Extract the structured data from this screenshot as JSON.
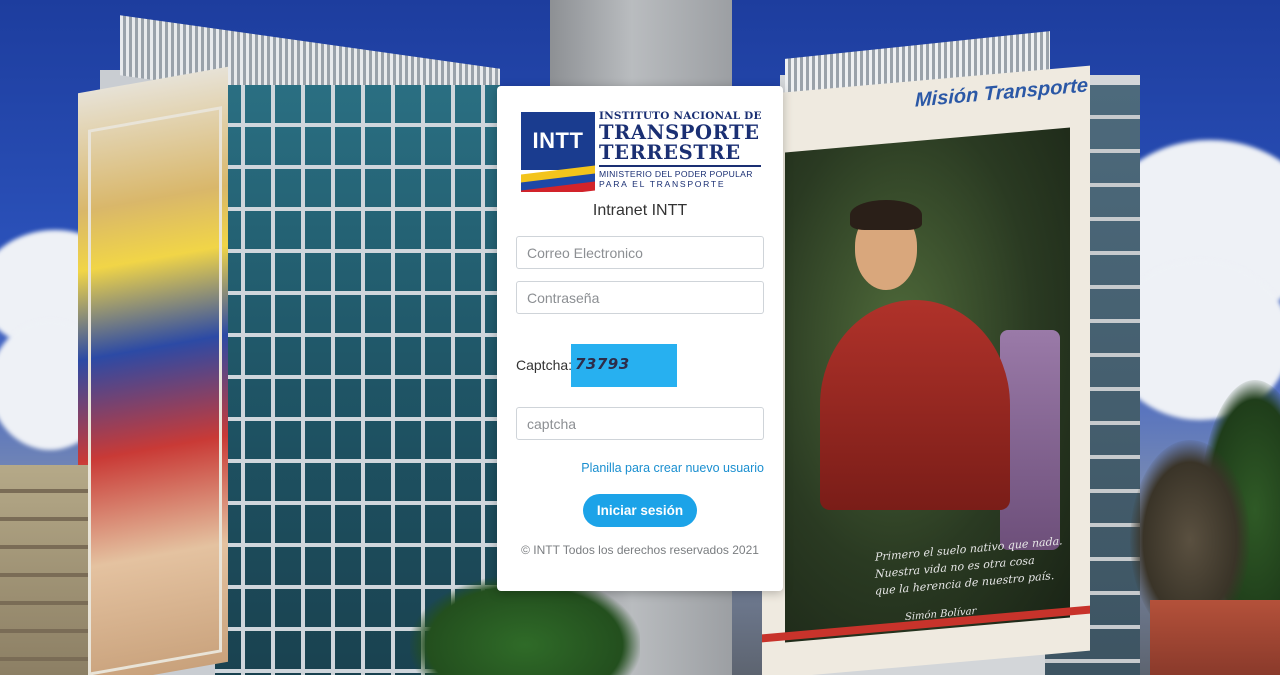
{
  "logo": {
    "abbr": "INTT",
    "line1": "INSTITUTO NACIONAL DE",
    "line2": "TRANSPORTE",
    "line3": "TERRESTRE",
    "ministry1": "MINISTERIO DEL PODER POPULAR",
    "ministry2": "PARA EL TRANSPORTE"
  },
  "title": "Intranet INTT",
  "form": {
    "email_placeholder": "Correo Electronico",
    "password_placeholder": "Contraseña",
    "captcha_label": "Captcha:",
    "captcha_code": "73793",
    "captcha_placeholder": "captcha",
    "signup_link": "Planilla para crear nuevo usuario",
    "login_button": "Iniciar sesión"
  },
  "footer": "© INTT Todos los derechos reservados 2021",
  "background": {
    "banner_logo": "Misión Transporte",
    "quote_lines": [
      "Primero el suelo nativo que nada.",
      "Nuestra vida no es otra cosa",
      "que la herencia de nuestro país."
    ],
    "quote_signature": "Simón Bolívar"
  },
  "colors": {
    "accent": "#1ca3e8",
    "captcha_bg": "#27b0f0",
    "link": "#1a8fd0",
    "logo_blue": "#1a3c8f"
  }
}
